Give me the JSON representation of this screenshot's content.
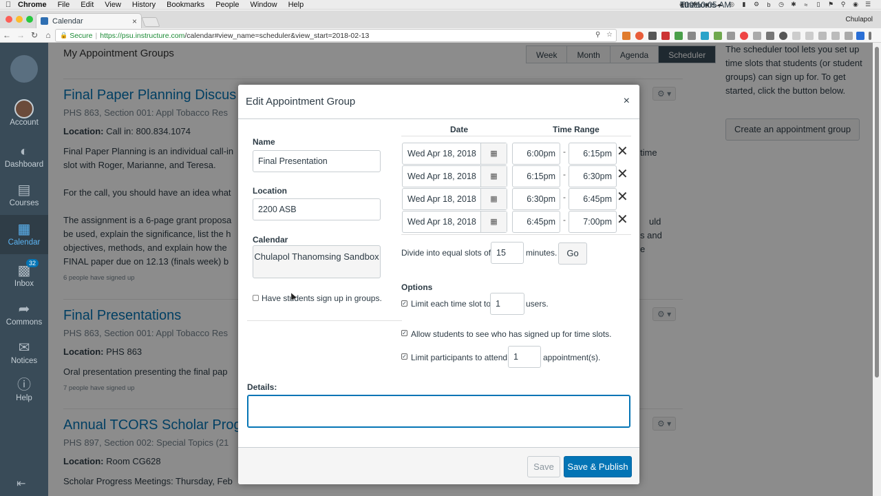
{
  "menubar": {
    "app": "Chrome",
    "items": [
      "File",
      "Edit",
      "View",
      "History",
      "Bookmarks",
      "People",
      "Window",
      "Help"
    ],
    "battery": "100%",
    "clock": "Tue 10:05 AM",
    "user": "cthanoms"
  },
  "browser": {
    "tab_title": "Calendar",
    "profile": "Chulapol",
    "secure_label": "Secure",
    "url_host": "https://psu.instructure.com",
    "url_path": "/calendar#view_name=scheduler&view_start=2018-02-13"
  },
  "global_nav": {
    "items": [
      {
        "label": "Account",
        "icon": "account-avatar"
      },
      {
        "label": "Dashboard",
        "icon": "dashboard-icon"
      },
      {
        "label": "Courses",
        "icon": "courses-icon"
      },
      {
        "label": "Calendar",
        "icon": "calendar-icon"
      },
      {
        "label": "Inbox",
        "icon": "inbox-icon",
        "badge": "32"
      },
      {
        "label": "Commons",
        "icon": "commons-icon"
      },
      {
        "label": "Notices",
        "icon": "notices-icon"
      },
      {
        "label": "Help",
        "icon": "help-icon"
      }
    ],
    "active": "Calendar"
  },
  "page": {
    "title": "My Appointment Groups",
    "view_tabs": [
      "Week",
      "Month",
      "Agenda",
      "Scheduler"
    ],
    "active_tab": "Scheduler",
    "help_text": "The scheduler tool lets you set up time slots that students (or student groups) can sign up for. To get started, click the button below.",
    "create_button": "Create an appointment group",
    "groups": [
      {
        "title": "Final Paper Planning Discus",
        "subtitle": "PHS 863, Section 001: Appl Tobacco Res",
        "location_label": "Location:",
        "location": "Call in: 800.834.1074",
        "desc1": "Final Paper Planning is an individual call-in",
        "desc1_tail": "time",
        "desc1b": "slot with Roger, Marianne, and Teresa.",
        "desc2": "For the call, you should have an idea what",
        "desc3": "The assignment is a 6-page grant proposa",
        "desc3_tail": "uld",
        "desc4": "be used, explain the significance, list the h",
        "desc4_tail": "s and",
        "desc5": "objectives, methods, and explain how the",
        "desc5_tail": "e",
        "desc6": "FINAL paper due on 12.13 (finals week) b",
        "signed": "6 people have signed up"
      },
      {
        "title": "Final Presentations",
        "subtitle": "PHS 863, Section 001: Appl Tobacco Res",
        "location_label": "Location:",
        "location": "PHS 863",
        "desc1": "Oral presentation presenting the final pap",
        "signed": "7 people have signed up"
      },
      {
        "title": "Annual TCORS Scholar Prog",
        "subtitle": "PHS 897, Section 002: Special Topics (21",
        "location_label": "Location:",
        "location": "Room CG628",
        "desc1": "Scholar Progress Meetings: Thursday, Feb"
      }
    ]
  },
  "modal": {
    "title": "Edit Appointment Group",
    "name_label": "Name",
    "name_value": "Final Presentation",
    "location_label": "Location",
    "location_value": "2200 ASB",
    "calendar_label": "Calendar",
    "calendar_value": "Chulapol Thanomsing Sandbox",
    "groups_checkbox": "Have students sign up in groups.",
    "col_date": "Date",
    "col_time": "Time Range",
    "slots": [
      {
        "date": "Wed Apr 18, 2018",
        "start": "6:00pm",
        "end": "6:15pm"
      },
      {
        "date": "Wed Apr 18, 2018",
        "start": "6:15pm",
        "end": "6:30pm"
      },
      {
        "date": "Wed Apr 18, 2018",
        "start": "6:30pm",
        "end": "6:45pm"
      },
      {
        "date": "Wed Apr 18, 2018",
        "start": "6:45pm",
        "end": "7:00pm"
      }
    ],
    "dash": "-",
    "divide_prefix": "Divide into equal slots of",
    "divide_value": "15",
    "divide_suffix": "minutes.",
    "go": "Go",
    "options_label": "Options",
    "opt1_prefix": "Limit each time slot to",
    "opt1_value": "1",
    "opt1_suffix": "users.",
    "opt2": "Allow students to see who has signed up for time slots.",
    "opt3_prefix": "Limit participants to attend",
    "opt3_value": "1",
    "opt3_suffix": "appointment(s).",
    "details_label": "Details:",
    "save": "Save",
    "save_publish": "Save & Publish"
  }
}
